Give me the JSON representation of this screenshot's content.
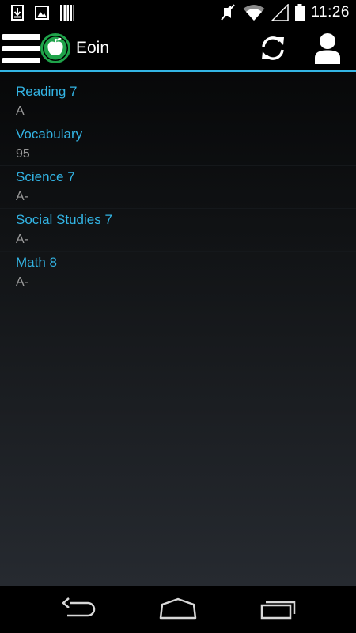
{
  "status_bar": {
    "time": "11:26",
    "left_icons": [
      "download-icon",
      "image-icon",
      "barcode-icon"
    ],
    "right_icons": [
      "mute-icon",
      "wifi-icon",
      "signal-icon",
      "battery-icon"
    ]
  },
  "action_bar": {
    "title": "Eoin",
    "accent_color": "#33b5e5",
    "logo_color": "#1fa34a",
    "icons": [
      "menu-icon",
      "apple-logo-icon",
      "refresh-icon",
      "profile-icon"
    ]
  },
  "courses": [
    {
      "name": "Reading 7",
      "grade": "A"
    },
    {
      "name": "Vocabulary",
      "grade": "95"
    },
    {
      "name": "Science 7",
      "grade": "A-"
    },
    {
      "name": "Social Studies 7",
      "grade": "A-"
    },
    {
      "name": "Math 8",
      "grade": "A-"
    }
  ],
  "nav_bar": {
    "icons": [
      "back-icon",
      "home-icon",
      "recents-icon"
    ]
  }
}
